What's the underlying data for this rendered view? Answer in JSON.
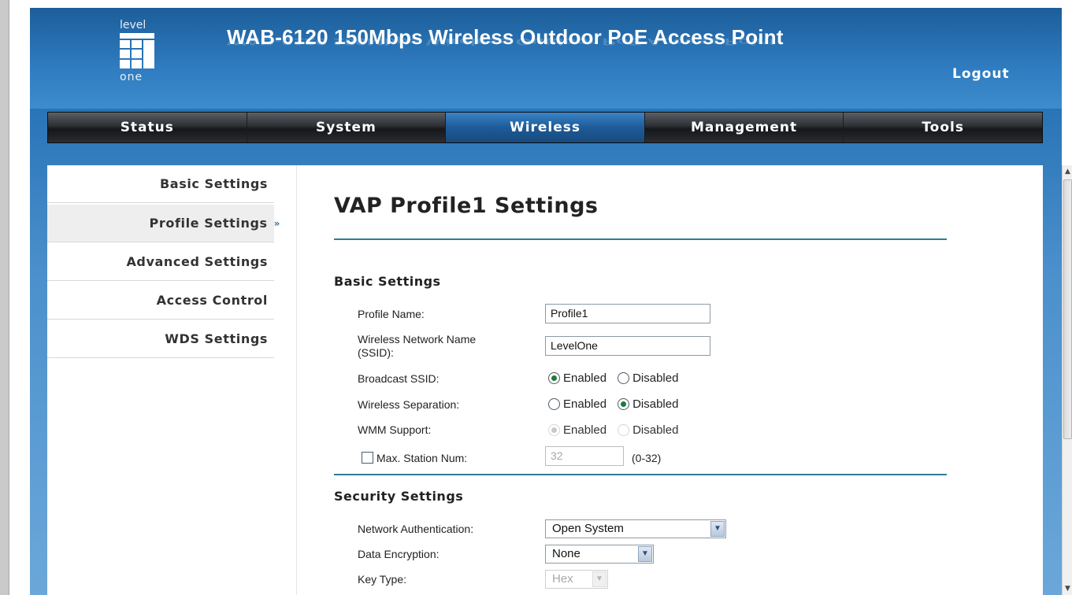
{
  "header": {
    "logo_text_top": "level",
    "logo_text_bottom": "one",
    "title": "WAB-6120 150Mbps Wireless Outdoor PoE Access Point",
    "logout": "Logout"
  },
  "nav": {
    "items": [
      {
        "label": "Status",
        "active": false
      },
      {
        "label": "System",
        "active": false
      },
      {
        "label": "Wireless",
        "active": true
      },
      {
        "label": "Management",
        "active": false
      },
      {
        "label": "Tools",
        "active": false
      }
    ]
  },
  "sidebar": {
    "items": [
      {
        "label": "Basic Settings"
      },
      {
        "label": "Profile Settings",
        "active": true,
        "marker": "»"
      },
      {
        "label": "Advanced Settings"
      },
      {
        "label": "Access Control"
      },
      {
        "label": "WDS Settings"
      }
    ]
  },
  "main": {
    "page_title": "VAP Profile1 Settings",
    "basic": {
      "title": "Basic Settings",
      "profile_name_label": "Profile Name:",
      "profile_name_value": "Profile1",
      "ssid_label_line1": "Wireless Network Name",
      "ssid_label_line2": "(SSID):",
      "ssid_value": "LevelOne",
      "broadcast_label": "Broadcast SSID:",
      "broadcast_enabled": "Enabled",
      "broadcast_disabled": "Disabled",
      "broadcast_selected": "Enabled",
      "separation_label": "Wireless Separation:",
      "separation_enabled": "Enabled",
      "separation_disabled": "Disabled",
      "separation_selected": "Disabled",
      "wmm_label": "WMM Support:",
      "wmm_enabled": "Enabled",
      "wmm_disabled": "Disabled",
      "wmm_selected": "Enabled",
      "max_station_label": "Max. Station Num:",
      "max_station_checked": false,
      "max_station_value": "32",
      "max_station_range": "(0-32)"
    },
    "security": {
      "title": "Security Settings",
      "auth_label": "Network Authentication:",
      "auth_value": "Open System",
      "encryption_label": "Data Encryption:",
      "encryption_value": "None",
      "key_type_label": "Key Type:",
      "key_type_value": "Hex"
    }
  },
  "colors": {
    "header_blue": "#2f7cc0",
    "nav_active": "#1e5b98",
    "rule": "#2d7d93",
    "radio_dot": "#1c7a3c"
  }
}
